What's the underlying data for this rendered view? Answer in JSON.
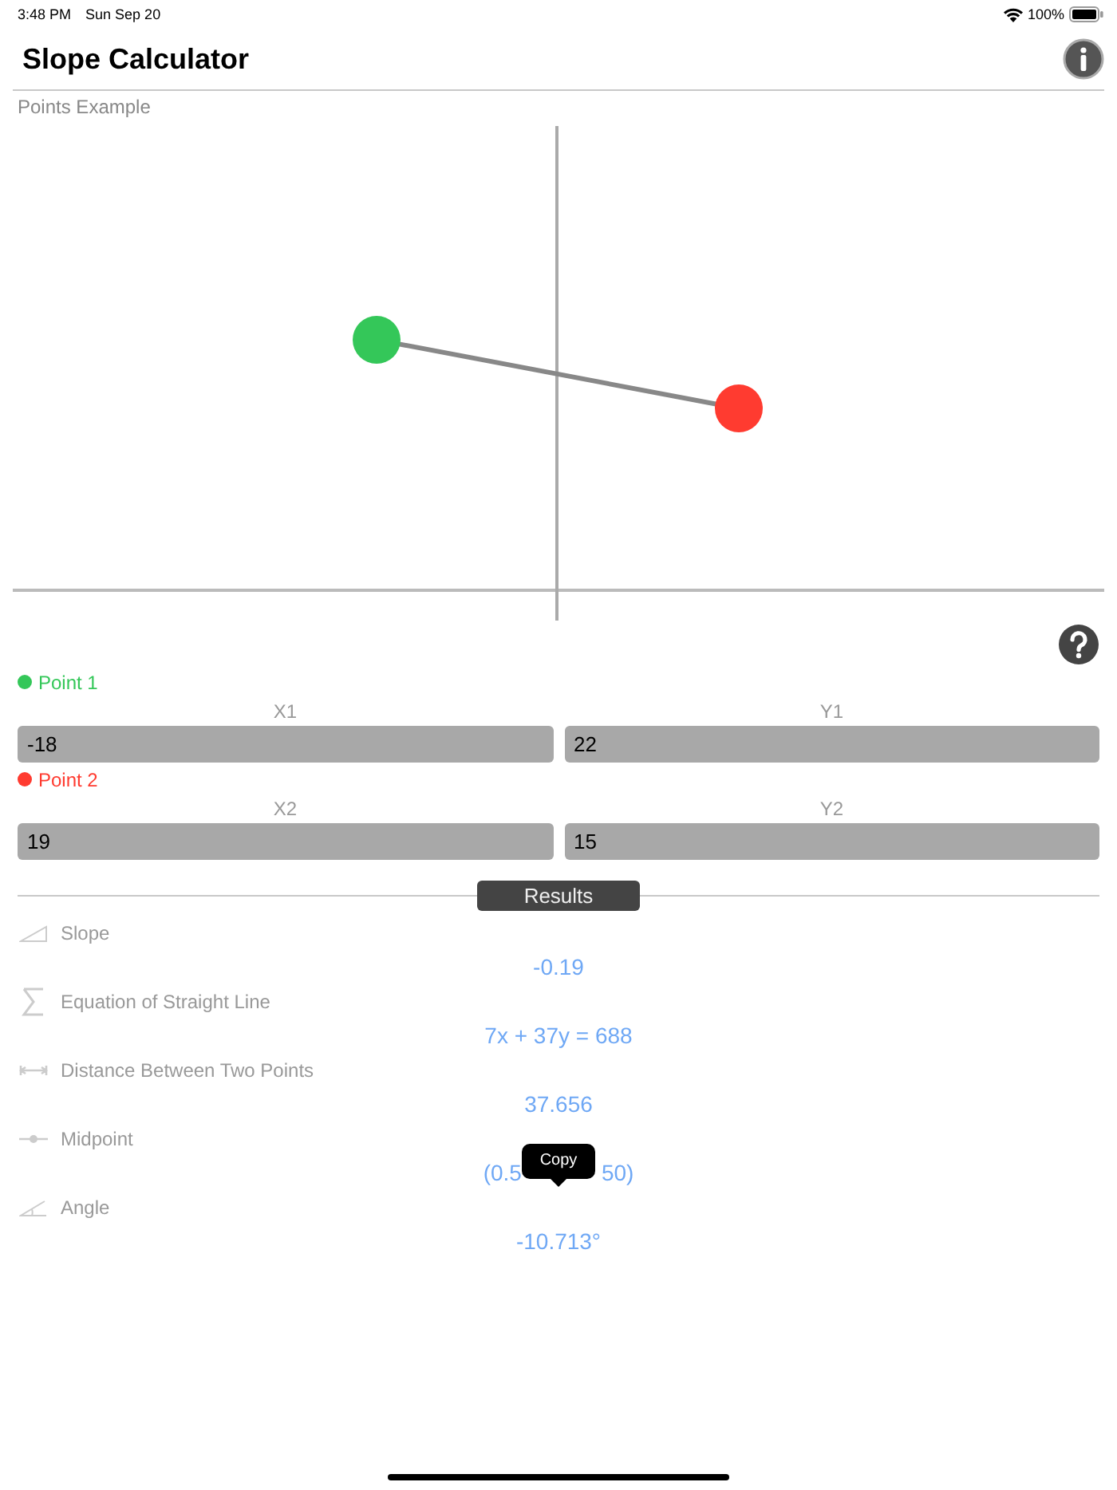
{
  "status_bar": {
    "time": "3:48 PM",
    "date": "Sun Sep 20",
    "battery": "100%"
  },
  "nav_bar": {
    "title": "Slope Calculator"
  },
  "plot": {
    "label": "Points Example"
  },
  "points": [
    {
      "label": "Point 1",
      "color": "#34c759",
      "fields": [
        {
          "label": "X1",
          "value": "-18"
        },
        {
          "label": "Y1",
          "value": "22"
        }
      ]
    },
    {
      "label": "Point 2",
      "color": "#ff3b30",
      "fields": [
        {
          "label": "X2",
          "value": "19"
        },
        {
          "label": "Y2",
          "value": "15"
        }
      ]
    }
  ],
  "results": {
    "title": "Results",
    "rows": [
      {
        "kind": "slope",
        "label": "Slope",
        "value": "-0.19"
      },
      {
        "kind": "equation",
        "label": "Equation of Straight Line",
        "value": "7x + 37y = 688"
      },
      {
        "kind": "distance",
        "label": "Distance Between Two Points",
        "value": "37.656"
      },
      {
        "kind": "midpoint",
        "label": "Midpoint",
        "value_parts": [
          "(0.5",
          "50)"
        ],
        "tooltip": "Copy"
      },
      {
        "kind": "angle",
        "label": "Angle",
        "value": "-10.713°"
      }
    ]
  }
}
